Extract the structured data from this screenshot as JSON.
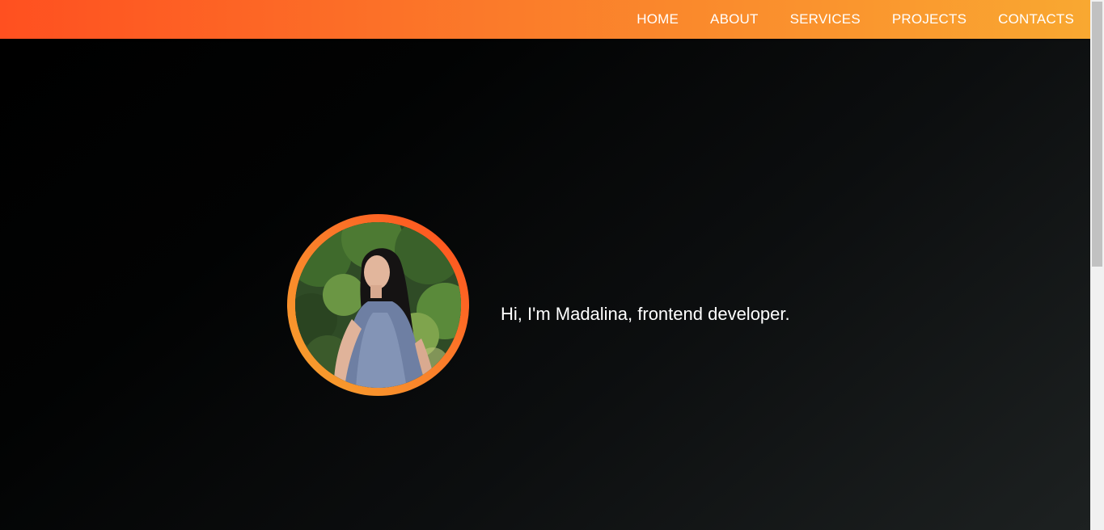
{
  "nav": {
    "items": [
      {
        "label": "HOME"
      },
      {
        "label": "ABOUT"
      },
      {
        "label": "SERVICES"
      },
      {
        "label": "PROJECTS"
      },
      {
        "label": "CONTACTS"
      }
    ]
  },
  "hero": {
    "headline": "Hi, I'm Madalina, frontend developer.",
    "avatar_icon": "profile-photo"
  },
  "colors": {
    "nav_gradient_start": "#ff5020",
    "nav_gradient_end": "#f9a831",
    "ring_gradient_start": "#ff4a1c",
    "ring_gradient_end": "#f6a52e",
    "background": "#000000",
    "text": "#ffffff"
  }
}
